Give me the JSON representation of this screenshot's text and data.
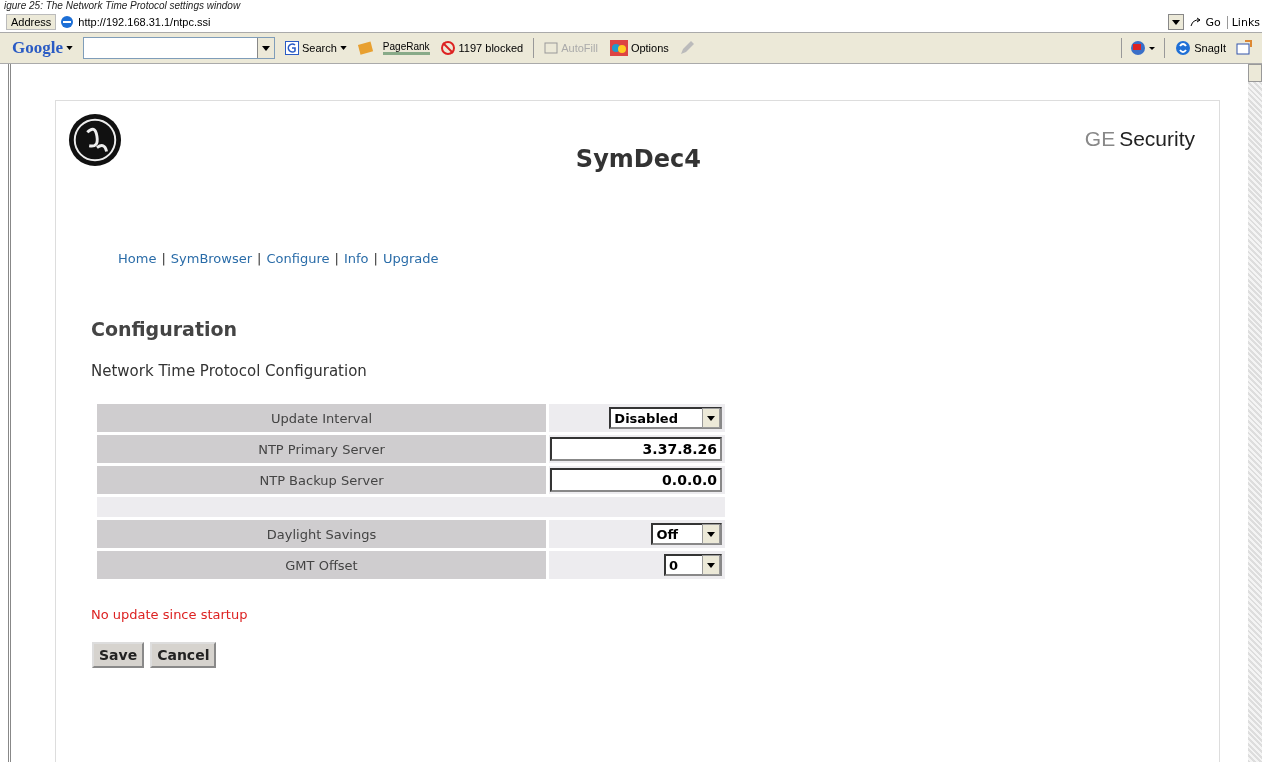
{
  "caption": "igure 25: The Network Time Protocol settings window",
  "address_bar": {
    "label": "Address",
    "url": "http://192.168.31.1/ntpc.ssi",
    "go": "Go",
    "links": "Links"
  },
  "toolbar": {
    "logo": "Google",
    "search": "Search",
    "pagerank": "PageRank",
    "blocked": "1197 blocked",
    "autofill": {
      "label": "AutoFill",
      "disabled": true
    },
    "options": "Options",
    "snagit": "SnagIt"
  },
  "page": {
    "brand": {
      "prefix": "GE",
      "name": "Security"
    },
    "title": "SymDec4",
    "nav": [
      {
        "kind": "link",
        "text": "Home"
      },
      {
        "kind": "separator",
        "text": "|"
      },
      {
        "kind": "link",
        "text": "SymBrowser"
      },
      {
        "kind": "separator",
        "text": "|"
      },
      {
        "kind": "link",
        "text": "Configure"
      },
      {
        "kind": "separator",
        "text": "|"
      },
      {
        "kind": "link",
        "text": "Info"
      },
      {
        "kind": "separator",
        "text": "|"
      },
      {
        "kind": "link",
        "text": "Upgrade"
      }
    ],
    "heading": "Configuration",
    "subheading": "Network Time Protocol Configuration",
    "rows": [
      {
        "kind": "select",
        "label": "Update Interval",
        "value": "Disabled"
      },
      {
        "kind": "input",
        "label": "NTP Primary Server",
        "value": "3.37.8.26"
      },
      {
        "kind": "input",
        "label": "NTP Backup Server",
        "value": "0.0.0.0"
      },
      {
        "kind": "spacer"
      },
      {
        "kind": "select",
        "label": "Daylight Savings",
        "value": "Off"
      },
      {
        "kind": "select",
        "label": "GMT Offset",
        "value": "0"
      }
    ],
    "status": "No update since startup",
    "buttons": [
      "Save",
      "Cancel"
    ]
  }
}
